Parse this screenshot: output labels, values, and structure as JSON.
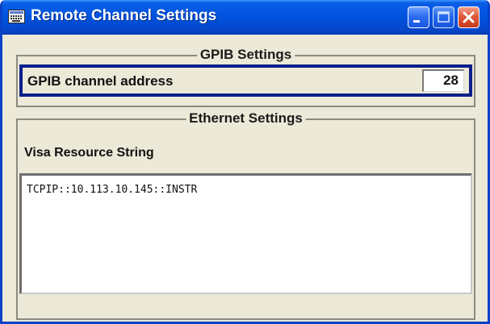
{
  "window": {
    "title": "Remote Channel Settings",
    "title_icon": "keyboard-icon",
    "controls": {
      "minimize": "minimize-icon",
      "maximize": "maximize-icon",
      "close": "close-icon"
    }
  },
  "gpib": {
    "group_title": "GPIB Settings",
    "channel_address_label": "GPIB channel address",
    "channel_address_value": "28"
  },
  "ethernet": {
    "group_title": "Ethernet Settings",
    "visa_label": "Visa Resource String",
    "visa_value": "TCPIP::10.113.10.145::INSTR"
  },
  "colors": {
    "titlebar": "#0255e0",
    "window_bg": "#ece9d8",
    "focus_border": "#0a1f8a",
    "close_button": "#e05a3a"
  }
}
